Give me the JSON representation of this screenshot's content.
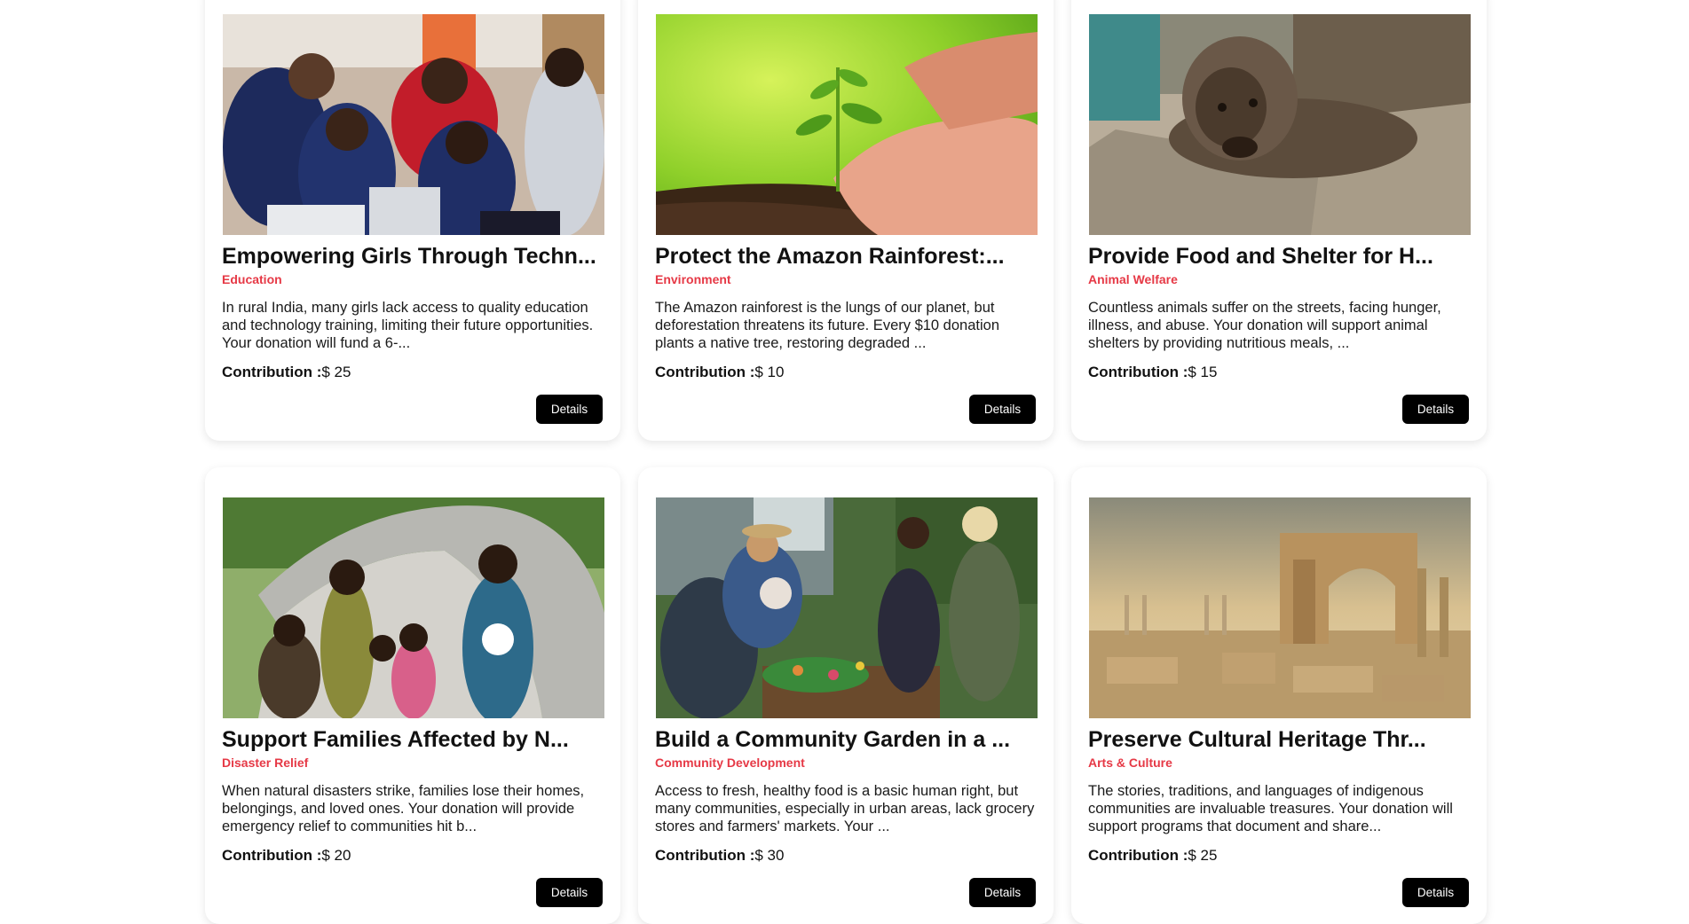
{
  "cards": [
    {
      "title": "Empowering Girls Through Techn...",
      "category": "Education",
      "description": "In rural India, many girls lack access to quality education and technology training, limiting their future opportunities. Your donation will fund a 6-...",
      "contribution_label": "Contribution :",
      "contribution_value": "$ 25",
      "button_label": "Details",
      "image": "girls-technology-classroom-photo"
    },
    {
      "title": "Protect the Amazon Rainforest:...",
      "category": "Environment",
      "description": "The Amazon rainforest is the lungs of our planet, but deforestation threatens its future. Every $10 donation plants a native tree, restoring degraded ...",
      "contribution_label": "Contribution :",
      "contribution_value": "$ 10",
      "button_label": "Details",
      "image": "seedling-in-hands-photo"
    },
    {
      "title": "Provide Food and Shelter for H...",
      "category": "Animal Welfare",
      "description": "Countless animals suffer on the streets, facing hunger, illness, and abuse. Your donation will support animal shelters by providing nutritious meals, ...",
      "contribution_label": "Contribution :",
      "contribution_value": "$ 15",
      "button_label": "Details",
      "image": "stray-dog-photo"
    },
    {
      "title": "Support Families Affected by N...",
      "category": "Disaster Relief",
      "description": "When natural disasters strike, families lose their homes, belongings, and loved ones. Your donation will provide emergency relief to communities hit b...",
      "contribution_label": "Contribution :",
      "contribution_value": "$ 20",
      "button_label": "Details",
      "image": "families-under-tarp-photo"
    },
    {
      "title": "Build a Community Garden in a ...",
      "category": "Community Development",
      "description": "Access to fresh, healthy food is a basic human right, but many communities, especially in urban areas, lack grocery stores and farmers' markets. Your ...",
      "contribution_label": "Contribution :",
      "contribution_value": "$ 30",
      "button_label": "Details",
      "image": "community-garden-photo"
    },
    {
      "title": "Preserve Cultural Heritage Thr...",
      "category": "Arts & Culture",
      "description": "The stories, traditions, and languages of indigenous communities are invaluable treasures. Your donation will support programs that document and share...",
      "contribution_label": "Contribution :",
      "contribution_value": "$ 25",
      "button_label": "Details",
      "image": "ancient-ruins-photo"
    }
  ],
  "colors": {
    "category": "#e63946",
    "button_bg": "#000000",
    "button_text": "#ffffff"
  }
}
